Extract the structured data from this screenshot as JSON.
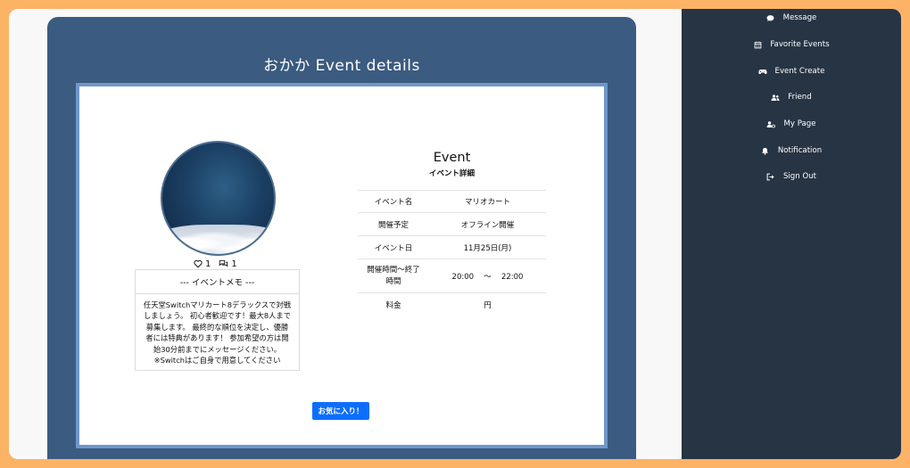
{
  "page_title": "おかか Event details",
  "stats": {
    "likes": "1",
    "comments": "1"
  },
  "memo": {
    "heading": "--- イベントメモ ---",
    "body": "任天堂Switchマリカート8デラックスで対戦\nしましょう。 初心者歓迎です！最大8人まで\n募集します。 最終的な順位を決定し、優勝\n者には特典があります！ 参加希望の方は開\n始30分前までにメッセージください。\n※Switchはご自身で用意してください"
  },
  "info": {
    "title": "Event",
    "subtitle": "イベント詳細",
    "rows": [
      {
        "label": "イベント名",
        "value": "マリオカート"
      },
      {
        "label": "開催予定",
        "value": "オフライン開催"
      },
      {
        "label": "イベント日",
        "value": "11月25日(月)"
      },
      {
        "label": "開催時間〜終了\n時間",
        "value": "20:00　 ～ 　22:00"
      },
      {
        "label": "料金",
        "value": "円"
      }
    ]
  },
  "favorite_button": "お気に入り！",
  "sidebar": {
    "items": [
      {
        "label": "Message",
        "icon": "message-icon"
      },
      {
        "label": "Favorite Events",
        "icon": "calendar-icon"
      },
      {
        "label": "Event Create",
        "icon": "gamepad-icon"
      },
      {
        "label": "Friend",
        "icon": "users-icon"
      },
      {
        "label": "My Page",
        "icon": "user-gear-icon"
      },
      {
        "label": "Notification",
        "icon": "bell-icon"
      },
      {
        "label": "Sign Out",
        "icon": "sign-out-icon"
      }
    ]
  },
  "colors": {
    "page_border": "#fcb366",
    "main_panel": "#3b5b80",
    "card_border": "#6f97c9",
    "sidebar": "#273444",
    "button": "#0d6efd"
  }
}
